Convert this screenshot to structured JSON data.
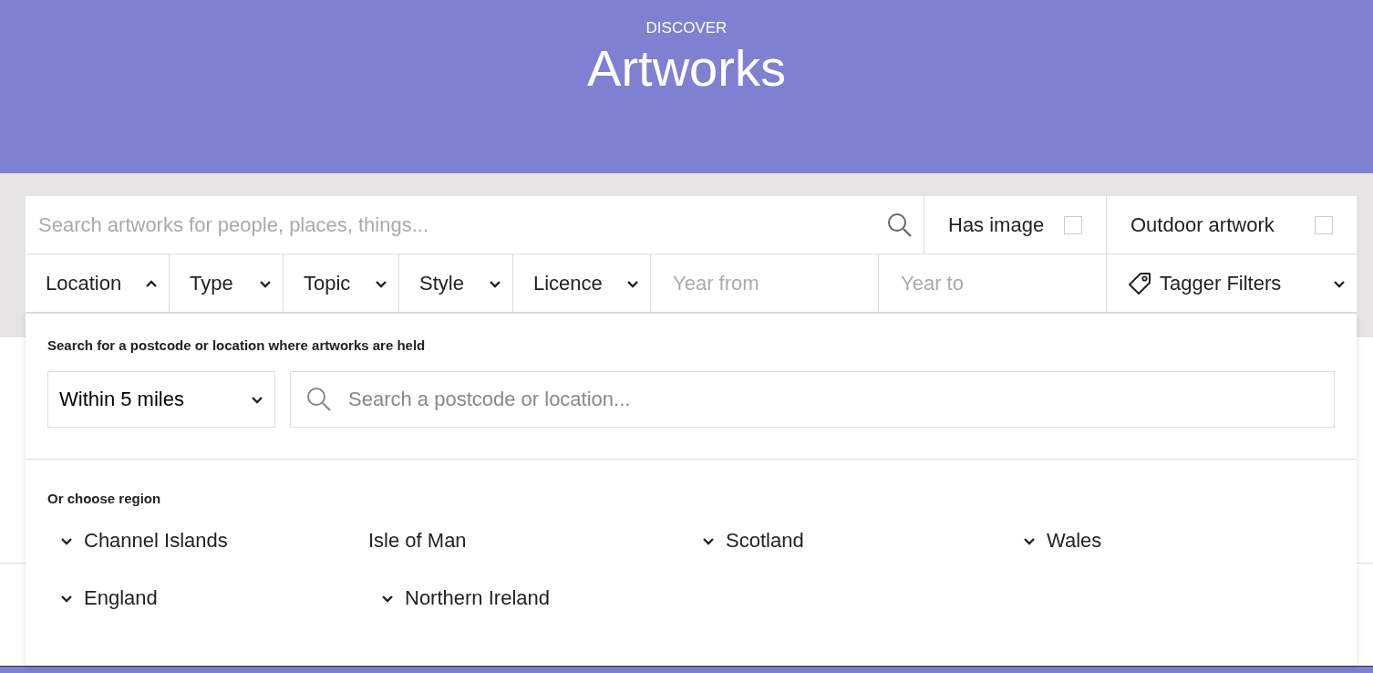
{
  "header": {
    "eyebrow": "DISCOVER",
    "title": "Artworks"
  },
  "search": {
    "placeholder": "Search artworks for people, places, things..."
  },
  "toggles": [
    {
      "label": "Has image",
      "checked": false
    },
    {
      "label": "Outdoor artwork",
      "checked": false
    }
  ],
  "filters": [
    {
      "kind": "dropdown",
      "label": "Location",
      "expanded": true
    },
    {
      "kind": "dropdown",
      "label": "Type",
      "expanded": false
    },
    {
      "kind": "dropdown",
      "label": "Topic",
      "expanded": false
    },
    {
      "kind": "dropdown",
      "label": "Style",
      "expanded": false
    },
    {
      "kind": "dropdown",
      "label": "Licence",
      "expanded": false
    },
    {
      "kind": "input",
      "placeholder": "Year from"
    },
    {
      "kind": "input",
      "placeholder": "Year to"
    },
    {
      "kind": "tagger",
      "label": "Tagger Filters",
      "expanded": false
    }
  ],
  "location_panel": {
    "heading": "Search for a postcode or location where artworks are held",
    "radius": "Within 5 miles",
    "location_placeholder": "Search a postcode or location...",
    "region_heading": "Or choose region",
    "regions": [
      {
        "label": "Channel Islands",
        "expandable": true
      },
      {
        "label": "Isle of Man",
        "expandable": false
      },
      {
        "label": "Scotland",
        "expandable": true
      },
      {
        "label": "Wales",
        "expandable": true
      },
      {
        "label": "England",
        "expandable": true
      },
      {
        "label": "Northern Ireland",
        "expandable": true
      }
    ]
  }
}
